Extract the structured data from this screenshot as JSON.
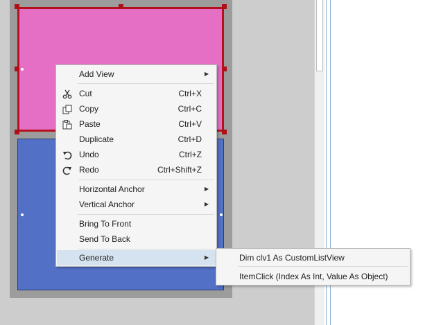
{
  "context_menu": {
    "items": [
      {
        "label": "Add View",
        "submenu": true
      },
      {
        "label": "Cut",
        "shortcut": "Ctrl+X",
        "icon": "scissors-icon"
      },
      {
        "label": "Copy",
        "shortcut": "Ctrl+C",
        "icon": "copy-icon"
      },
      {
        "label": "Paste",
        "shortcut": "Ctrl+V",
        "icon": "paste-icon"
      },
      {
        "label": "Duplicate",
        "shortcut": "Ctrl+D"
      },
      {
        "label": "Undo",
        "shortcut": "Ctrl+Z",
        "icon": "undo-icon"
      },
      {
        "label": "Redo",
        "shortcut": "Ctrl+Shift+Z",
        "icon": "redo-icon"
      },
      {
        "label": "Horizontal Anchor",
        "submenu": true
      },
      {
        "label": "Vertical Anchor",
        "submenu": true
      },
      {
        "label": "Bring To Front"
      },
      {
        "label": "Send To Back"
      },
      {
        "label": "Generate",
        "submenu": true,
        "highlighted": true
      }
    ]
  },
  "generate_submenu": {
    "items": [
      {
        "label": "Dim clv1 As CustomListView"
      },
      {
        "label": "ItemClick (Index As Int, Value As Object)"
      }
    ]
  },
  "colors": {
    "pink_view": "#e46fc5",
    "pink_border": "#b4111d",
    "blue_view": "#5270c5",
    "menu_highlight": "#d5e2ef"
  }
}
